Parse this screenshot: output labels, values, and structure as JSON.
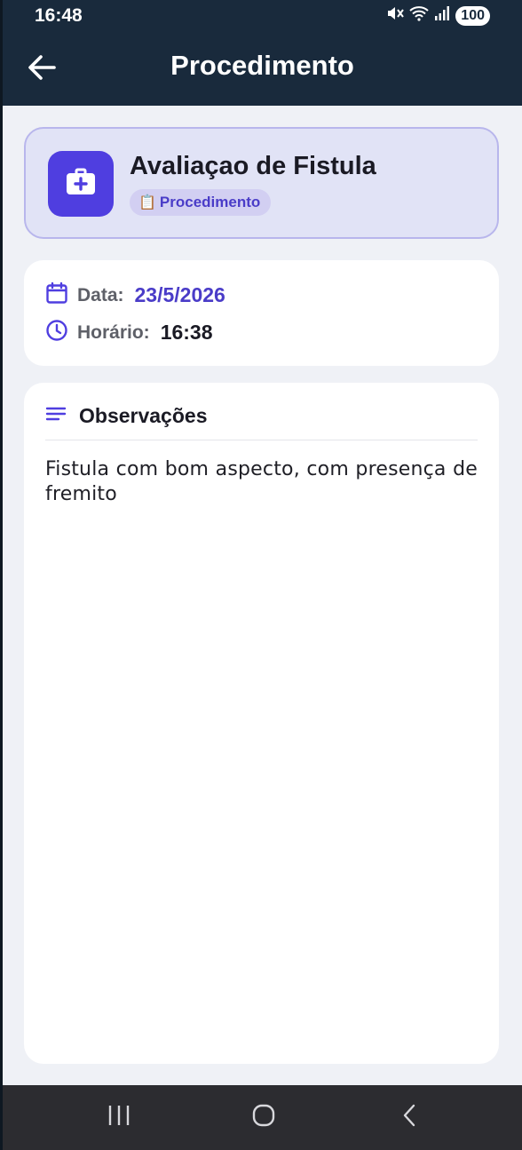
{
  "status_bar": {
    "time": "16:48",
    "battery": "100",
    "icons": [
      "mute-icon",
      "wifi-icon",
      "signal-icon"
    ]
  },
  "app_bar": {
    "back_icon": "arrow-left-icon",
    "title": "Procedimento"
  },
  "header": {
    "icon": "medical-kit-icon",
    "title": "Avaliaçao de Fistula",
    "badge_icon": "clipboard-icon",
    "badge_emoji": "📋",
    "badge_label": "Procedimento"
  },
  "info": {
    "date_icon": "calendar-icon",
    "date_label": "Data:",
    "date_value": "23/5/2026",
    "time_icon": "clock-icon",
    "time_label": "Horário:",
    "time_value": "16:38"
  },
  "observations": {
    "icon": "notes-lines-icon",
    "title": "Observações",
    "text": "Fistula com bom aspecto, com presença de fremito"
  },
  "nav_bar": {
    "buttons": [
      "recent-apps-icon",
      "home-icon",
      "back-icon"
    ]
  },
  "colors": {
    "app_bar": "#192a3c",
    "accent": "#4f3ee0",
    "accent_text": "#4a3cc8",
    "background": "#eff1f6",
    "header_card": "#e1e3f6"
  }
}
